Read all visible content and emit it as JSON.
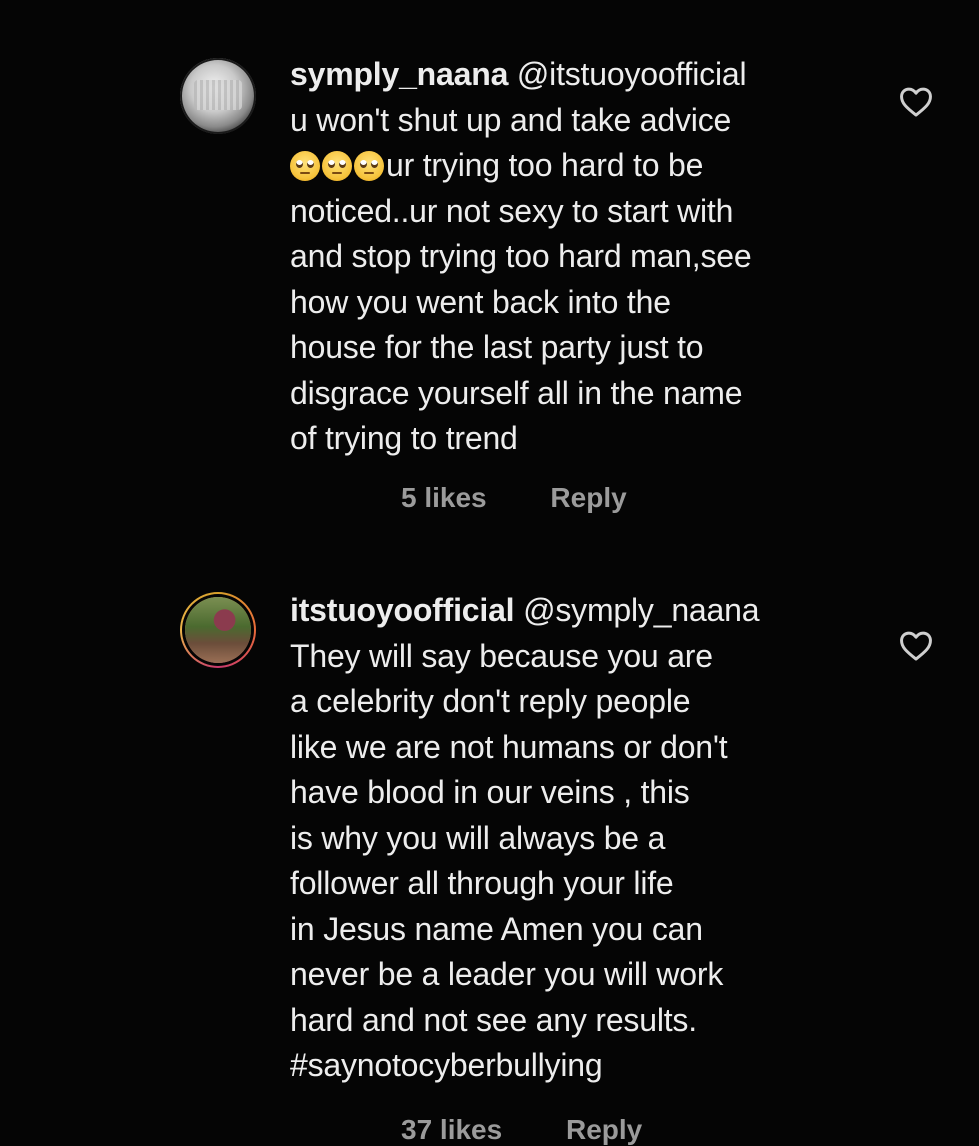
{
  "comments": [
    {
      "username": "symply_naana",
      "mention": "@itstuoyoofficial",
      "emoji": "🙄",
      "lines": [
        "u won't shut up and take advice",
        "ur trying too hard to be",
        "noticed..ur not sexy to start with",
        "and stop trying too hard man,see",
        "how you went back into the",
        "house for the last party just to",
        "disgrace yourself all in the name",
        "of trying to trend"
      ],
      "likes": "5 likes",
      "reply": "Reply"
    },
    {
      "username": "itstuoyoofficial",
      "mention": "@symply_naana",
      "lines": [
        "They will say because you are",
        "a celebrity don't reply people",
        "like we are not humans or don't",
        "have blood in our veins , this",
        "is why you will always be a",
        "follower all through your life",
        "in Jesus name Amen  you can",
        "never be a leader you  will work",
        "hard and not see any results.",
        "#saynotocyberbullying"
      ],
      "likes": "37 likes",
      "reply": "Reply"
    }
  ],
  "icons": {
    "like": "heart-outline-icon",
    "emoji": "face-with-rolling-eyes"
  },
  "colors": {
    "background": "#050505",
    "text": "#ededed",
    "meta": "#9b9b9b"
  }
}
